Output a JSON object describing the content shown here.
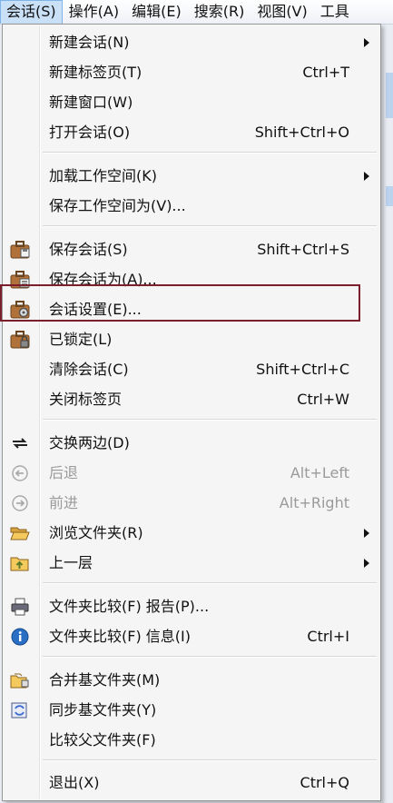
{
  "menubar": {
    "items": [
      "会话(S)",
      "操作(A)",
      "编辑(E)",
      "搜索(R)",
      "视图(V)",
      "工具"
    ]
  },
  "menu": {
    "items": [
      {
        "label": "新建会话(N)",
        "submenu": true
      },
      {
        "label": "新建标签页(T)",
        "shortcut": "Ctrl+T"
      },
      {
        "label": "新建窗口(W)"
      },
      {
        "label": "打开会话(O)",
        "shortcut": "Shift+Ctrl+O"
      },
      {
        "label": "加载工作空间(K)",
        "submenu": true
      },
      {
        "label": "保存工作空间为(V)..."
      },
      {
        "label": "保存会话(S)",
        "shortcut": "Shift+Ctrl+S",
        "icon": "briefcase-save-icon"
      },
      {
        "label": "保存会话为(A)...",
        "icon": "briefcase-saveas-icon"
      },
      {
        "label": "会话设置(E)...",
        "icon": "briefcase-settings-icon"
      },
      {
        "label": "已锁定(L)",
        "icon": "briefcase-lock-icon"
      },
      {
        "label": "清除会话(C)",
        "shortcut": "Shift+Ctrl+C"
      },
      {
        "label": "关闭标签页",
        "shortcut": "Ctrl+W"
      },
      {
        "label": "交换两边(D)",
        "icon": "swap-icon"
      },
      {
        "label": "后退",
        "shortcut": "Alt+Left",
        "disabled": true,
        "icon": "back-icon"
      },
      {
        "label": "前进",
        "shortcut": "Alt+Right",
        "disabled": true,
        "icon": "forward-icon"
      },
      {
        "label": "浏览文件夹(R)",
        "submenu": true,
        "icon": "folder-open-icon"
      },
      {
        "label": "上一层",
        "submenu": true,
        "icon": "folder-up-icon"
      },
      {
        "label": "文件夹比较(F) 报告(P)...",
        "icon": "printer-icon"
      },
      {
        "label": "文件夹比较(F) 信息(I)",
        "shortcut": "Ctrl+I",
        "icon": "info-icon"
      },
      {
        "label": "合并基文件夹(M)",
        "icon": "merge-folder-icon"
      },
      {
        "label": "同步基文件夹(Y)",
        "icon": "sync-folder-icon"
      },
      {
        "label": "比较父文件夹(F)"
      },
      {
        "label": "退出(X)",
        "shortcut": "Ctrl+Q"
      }
    ]
  },
  "colors": {
    "highlight_border": "#7a1f2b",
    "menu_bg": "#f5f5f5",
    "active_menubar": "#c9e0f7"
  }
}
